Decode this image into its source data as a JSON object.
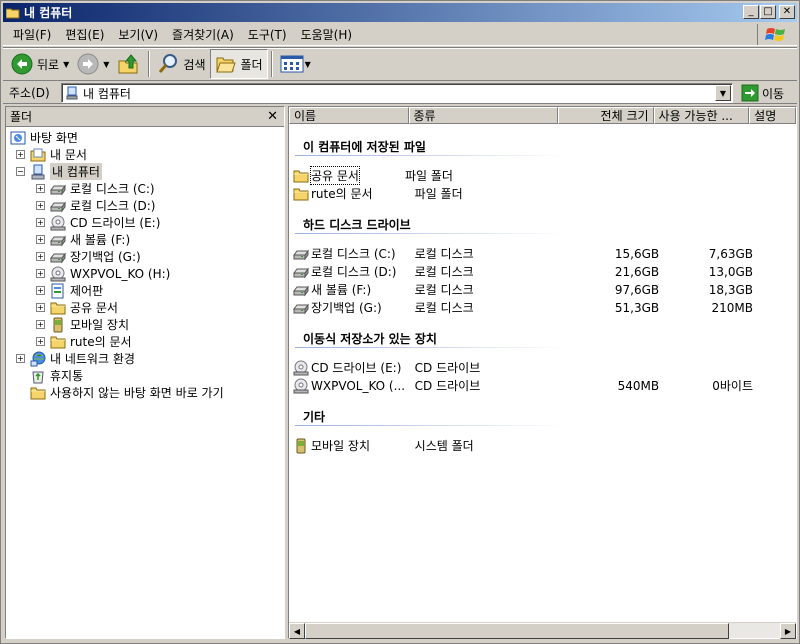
{
  "window": {
    "title": "내 컴퓨터"
  },
  "menu": [
    "파일(F)",
    "편집(E)",
    "보기(V)",
    "즐겨찾기(A)",
    "도구(T)",
    "도움말(H)"
  ],
  "toolbar": {
    "back": "뒤로",
    "search": "검색",
    "folders": "폴더"
  },
  "address": {
    "label": "주소(D)",
    "value": "내 컴퓨터",
    "go": "이동"
  },
  "folder_pane": {
    "title": "폴더",
    "tree": [
      {
        "label": "바탕 화면",
        "icon": "desktop-icon",
        "level": 0,
        "exp": ""
      },
      {
        "label": "내 문서",
        "icon": "my-documents-icon",
        "level": 1,
        "exp": "+"
      },
      {
        "label": "내 컴퓨터",
        "icon": "my-computer-icon",
        "level": 1,
        "exp": "-",
        "selected": true
      },
      {
        "label": "로컬 디스크 (C:)",
        "icon": "hard-drive-icon",
        "level": 2,
        "exp": "+"
      },
      {
        "label": "로컬 디스크 (D:)",
        "icon": "hard-drive-icon",
        "level": 2,
        "exp": "+"
      },
      {
        "label": "CD 드라이브 (E:)",
        "icon": "cd-drive-icon",
        "level": 2,
        "exp": "+"
      },
      {
        "label": "새 볼륨 (F:)",
        "icon": "hard-drive-icon",
        "level": 2,
        "exp": "+"
      },
      {
        "label": "장기백업 (G:)",
        "icon": "hard-drive-icon",
        "level": 2,
        "exp": "+"
      },
      {
        "label": "WXPVOL_KO (H:)",
        "icon": "cd-drive-icon",
        "level": 2,
        "exp": "+"
      },
      {
        "label": "제어판",
        "icon": "control-panel-icon",
        "level": 2,
        "exp": "+"
      },
      {
        "label": "공유 문서",
        "icon": "folder-icon",
        "level": 2,
        "exp": "+"
      },
      {
        "label": "모바일 장치",
        "icon": "mobile-device-icon",
        "level": 2,
        "exp": "+"
      },
      {
        "label": "rute의 문서",
        "icon": "folder-icon",
        "level": 2,
        "exp": "+"
      },
      {
        "label": "내 네트워크 환경",
        "icon": "network-icon",
        "level": 1,
        "exp": "+"
      },
      {
        "label": "휴지통",
        "icon": "recycle-bin-icon",
        "level": 1,
        "exp": ""
      },
      {
        "label": "사용하지 않는 바탕 화면 바로 가기",
        "icon": "folder-icon",
        "level": 1,
        "exp": ""
      }
    ]
  },
  "columns": [
    "이름",
    "종류",
    "전체 크기",
    "사용 가능한 ...",
    "설명"
  ],
  "groups": [
    {
      "title": "이 컴퓨터에 저장된 파일",
      "items": [
        {
          "name": "공유 문서",
          "type": "파일 폴더",
          "total": "",
          "free": "",
          "icon": "folder-icon",
          "focused": true
        },
        {
          "name": "rute의 문서",
          "type": "파일 폴더",
          "total": "",
          "free": "",
          "icon": "folder-icon"
        }
      ]
    },
    {
      "title": "하드 디스크 드라이브",
      "items": [
        {
          "name": "로컬 디스크 (C:)",
          "type": "로컬 디스크",
          "total": "15,6GB",
          "free": "7,63GB",
          "icon": "hard-drive-icon"
        },
        {
          "name": "로컬 디스크 (D:)",
          "type": "로컬 디스크",
          "total": "21,6GB",
          "free": "13,0GB",
          "icon": "hard-drive-icon"
        },
        {
          "name": "새 볼륨 (F:)",
          "type": "로컬 디스크",
          "total": "97,6GB",
          "free": "18,3GB",
          "icon": "hard-drive-icon"
        },
        {
          "name": "장기백업 (G:)",
          "type": "로컬 디스크",
          "total": "51,3GB",
          "free": "210MB",
          "icon": "hard-drive-icon"
        }
      ]
    },
    {
      "title": "이동식 저장소가 있는 장치",
      "items": [
        {
          "name": "CD 드라이브 (E:)",
          "type": "CD 드라이브",
          "total": "",
          "free": "",
          "icon": "cd-drive-icon"
        },
        {
          "name": "WXPVOL_KO (...",
          "type": "CD 드라이브",
          "total": "540MB",
          "free": "0바이트",
          "icon": "cd-drive-icon"
        }
      ]
    },
    {
      "title": "기타",
      "items": [
        {
          "name": "모바일 장치",
          "type": "시스템 폴더",
          "total": "",
          "free": "",
          "icon": "mobile-device-icon"
        }
      ]
    }
  ]
}
